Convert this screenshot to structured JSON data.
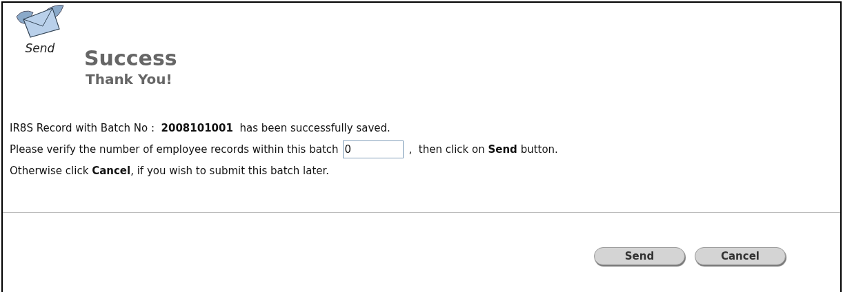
{
  "icon_label": "Send",
  "heading": {
    "title": "Success",
    "subtitle": "Thank You!"
  },
  "message": {
    "line_1": "IR8S Record with Batch No :  **2008101001**  has been successfully saved.",
    "line_2_before": "Please verify the number of employee records within this batch",
    "count_field": {
      "value": "0"
    },
    "line_2_after": ",  then click on **Send** button.",
    "line_3": "Otherwise click **Cancel**, if you wish to submit this batch later."
  },
  "buttons": [
    "Send",
    "Cancel"
  ]
}
